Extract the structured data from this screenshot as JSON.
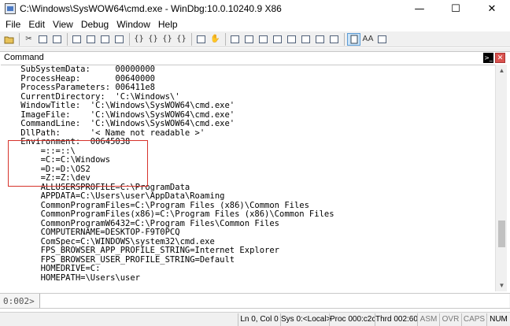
{
  "window": {
    "title": "C:\\Windows\\SysWOW64\\cmd.exe - WinDbg:10.0.10240.9 X86",
    "minimize": "—",
    "maximize": "☐",
    "close": "✕"
  },
  "menu": [
    "File",
    "Edit",
    "View",
    "Debug",
    "Window",
    "Help"
  ],
  "toolbar": {
    "icons": [
      "open-icon",
      "cut-icon",
      "copy-icon",
      "paste-icon",
      "go-icon",
      "restart-icon",
      "stop-icon",
      "break-icon",
      "step-into-icon",
      "step-over-icon",
      "step-out-icon",
      "run-to-cursor-icon",
      "breakpoint-icon",
      "hand-icon",
      "command-window-icon",
      "watch-window-icon",
      "locals-window-icon",
      "registers-window-icon",
      "memory-window-icon",
      "call-stack-icon",
      "disassembly-icon",
      "scratch-pad-icon",
      "source-mode-icon",
      "font-icon",
      "options-icon"
    ],
    "font_glyph": "AA"
  },
  "command_window": {
    "title": "Command",
    "terminal_glyph": ">_",
    "close_glyph": "✕"
  },
  "output_lines": [
    "    SubSystemData:     00000000",
    "    ProcessHeap:       00640000",
    "    ProcessParameters: 006411e8",
    "    CurrentDirectory:  'C:\\Windows\\'",
    "    WindowTitle:  'C:\\Windows\\SysWOW64\\cmd.exe'",
    "    ImageFile:    'C:\\Windows\\SysWOW64\\cmd.exe'",
    "    CommandLine:  'C:\\Windows\\SysWOW64\\cmd.exe'",
    "    DllPath:      '< Name not readable >'",
    "    Environment:  00645038",
    "        =::=::\\",
    "        =C:=C:\\Windows",
    "        =D:=D:\\OS2",
    "        =Z:=Z:\\dev",
    "        ALLUSERSPROFILE=C:\\ProgramData",
    "        APPDATA=C:\\Users\\user\\AppData\\Roaming",
    "        CommonProgramFiles=C:\\Program Files (x86)\\Common Files",
    "        CommonProgramFiles(x86)=C:\\Program Files (x86)\\Common Files",
    "        CommonProgramW6432=C:\\Program Files\\Common Files",
    "        COMPUTERNAME=DESKTOP-F9T0PCQ",
    "        ComSpec=C:\\WINDOWS\\system32\\cmd.exe",
    "        FPS_BROWSER_APP_PROFILE_STRING=Internet Explorer",
    "        FPS_BROWSER_USER_PROFILE_STRING=Default",
    "        HOMEDRIVE=C:",
    "        HOMEPATH=\\Users\\user"
  ],
  "prompt": {
    "label": "0:002>",
    "value": ""
  },
  "status": {
    "position": "Ln 0, Col 0",
    "sys": "Sys 0:<Local>",
    "proc": "Proc 000:c2c",
    "thrd": "Thrd 002:60",
    "asm": "ASM",
    "ovr": "OVR",
    "caps": "CAPS",
    "num": "NUM"
  },
  "colors": {
    "highlight": "#d6332b"
  }
}
